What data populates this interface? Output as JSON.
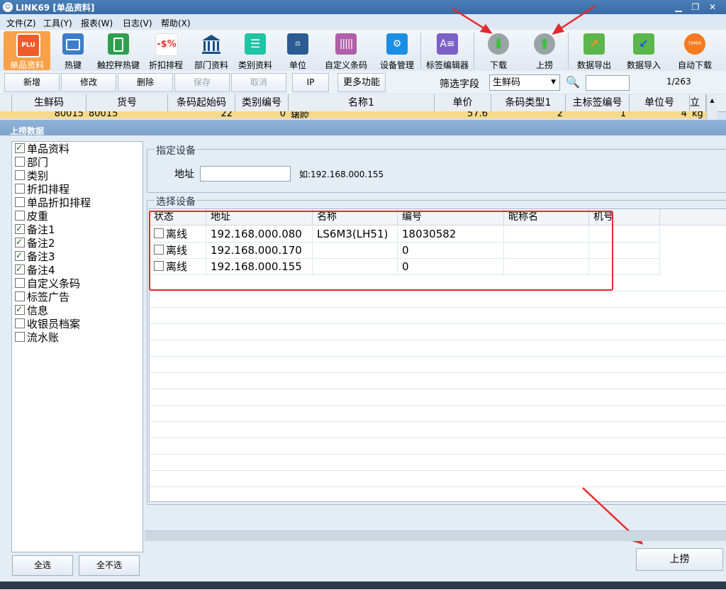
{
  "window": {
    "title": "LINK69 [单品资料]"
  },
  "menu": [
    "文件(Z)",
    "工具(Y)",
    "报表(W)",
    "日志(V)",
    "帮助(X)"
  ],
  "toolbar": {
    "items": [
      {
        "label": "单品资料",
        "icon": "gift-box-icon",
        "selected": true
      },
      {
        "label": "热键",
        "icon": "keyboard-icon"
      },
      {
        "label": "触控秤热键",
        "icon": "touch-scale-icon"
      },
      {
        "label": "折扣排程",
        "icon": "discount-icon",
        "glyph": "-$%"
      },
      {
        "label": "部门资料",
        "icon": "building-icon"
      },
      {
        "label": "类别资料",
        "icon": "list-icon"
      },
      {
        "label": "单位",
        "icon": "scale-unit-icon"
      },
      {
        "label": "自定义条码",
        "icon": "barcode-icon"
      },
      {
        "label": "设备管理",
        "icon": "device-icon"
      },
      {
        "label": "标签编辑器",
        "icon": "label-editor-icon"
      },
      {
        "label": "下载",
        "icon": "download-icon"
      },
      {
        "label": "上捞",
        "icon": "upload-icon"
      },
      {
        "label": "数据导出",
        "icon": "data-export-icon"
      },
      {
        "label": "数据导入",
        "icon": "data-import-icon"
      },
      {
        "label": "自动下载",
        "icon": "timer-icon",
        "glyph": "TIMER"
      }
    ]
  },
  "actions": {
    "add": "新增",
    "edit": "修改",
    "delete": "删除",
    "save": "保存",
    "cancel": "取消",
    "ip": "IP",
    "more": "更多功能",
    "filter_label": "筛选字段",
    "filter_value": "生鲜码",
    "search_value": "",
    "page": "1/263"
  },
  "grid": {
    "columns": [
      "生鲜码",
      "货号",
      "条码起始码",
      "类别编号",
      "名称1",
      "单价",
      "条码类型1",
      "主标签编号",
      "单位号",
      "立名"
    ],
    "row": [
      "80015",
      "80015",
      "22",
      "0",
      "猪腔",
      "57.6",
      "2",
      "1",
      "4",
      "kg"
    ]
  },
  "dialog": {
    "title": "上捞数据",
    "checklist": [
      {
        "label": "单品资料",
        "checked": true
      },
      {
        "label": "部门",
        "checked": false
      },
      {
        "label": "类别",
        "checked": false
      },
      {
        "label": "折扣排程",
        "checked": false
      },
      {
        "label": "单品折扣排程",
        "checked": false
      },
      {
        "label": "皮重",
        "checked": false
      },
      {
        "label": "备注1",
        "checked": true
      },
      {
        "label": "备注2",
        "checked": true
      },
      {
        "label": "备注3",
        "checked": true
      },
      {
        "label": "备注4",
        "checked": true
      },
      {
        "label": "自定义条码",
        "checked": false
      },
      {
        "label": "标签广告",
        "checked": false
      },
      {
        "label": "信息",
        "checked": true
      },
      {
        "label": "收银员档案",
        "checked": false
      },
      {
        "label": "流水账",
        "checked": false
      }
    ],
    "select_all": "全选",
    "select_none": "全不选",
    "specify_device": {
      "group": "指定设备",
      "address_label": "地址",
      "address_value": "",
      "hint": "如:192.168.000.155"
    },
    "select_device": {
      "group": "选择设备",
      "columns": [
        "状态",
        "地址",
        "名称",
        "编号",
        "昵称名",
        "机号"
      ],
      "rows": [
        {
          "status": "离线",
          "address": "192.168.000.080",
          "name": "LS6M3(LH51)",
          "number": "18030582",
          "nickname": "",
          "machine": ""
        },
        {
          "status": "离线",
          "address": "192.168.000.170",
          "name": "",
          "number": "0",
          "nickname": "",
          "machine": ""
        },
        {
          "status": "离线",
          "address": "192.168.000.155",
          "name": "",
          "number": "0",
          "nickname": "",
          "machine": ""
        }
      ]
    },
    "submit": "上捞"
  },
  "colors": {
    "highlight_box": "#e8282d",
    "selected_tool": "#f7a24b",
    "selected_row": "#f6d98a"
  }
}
